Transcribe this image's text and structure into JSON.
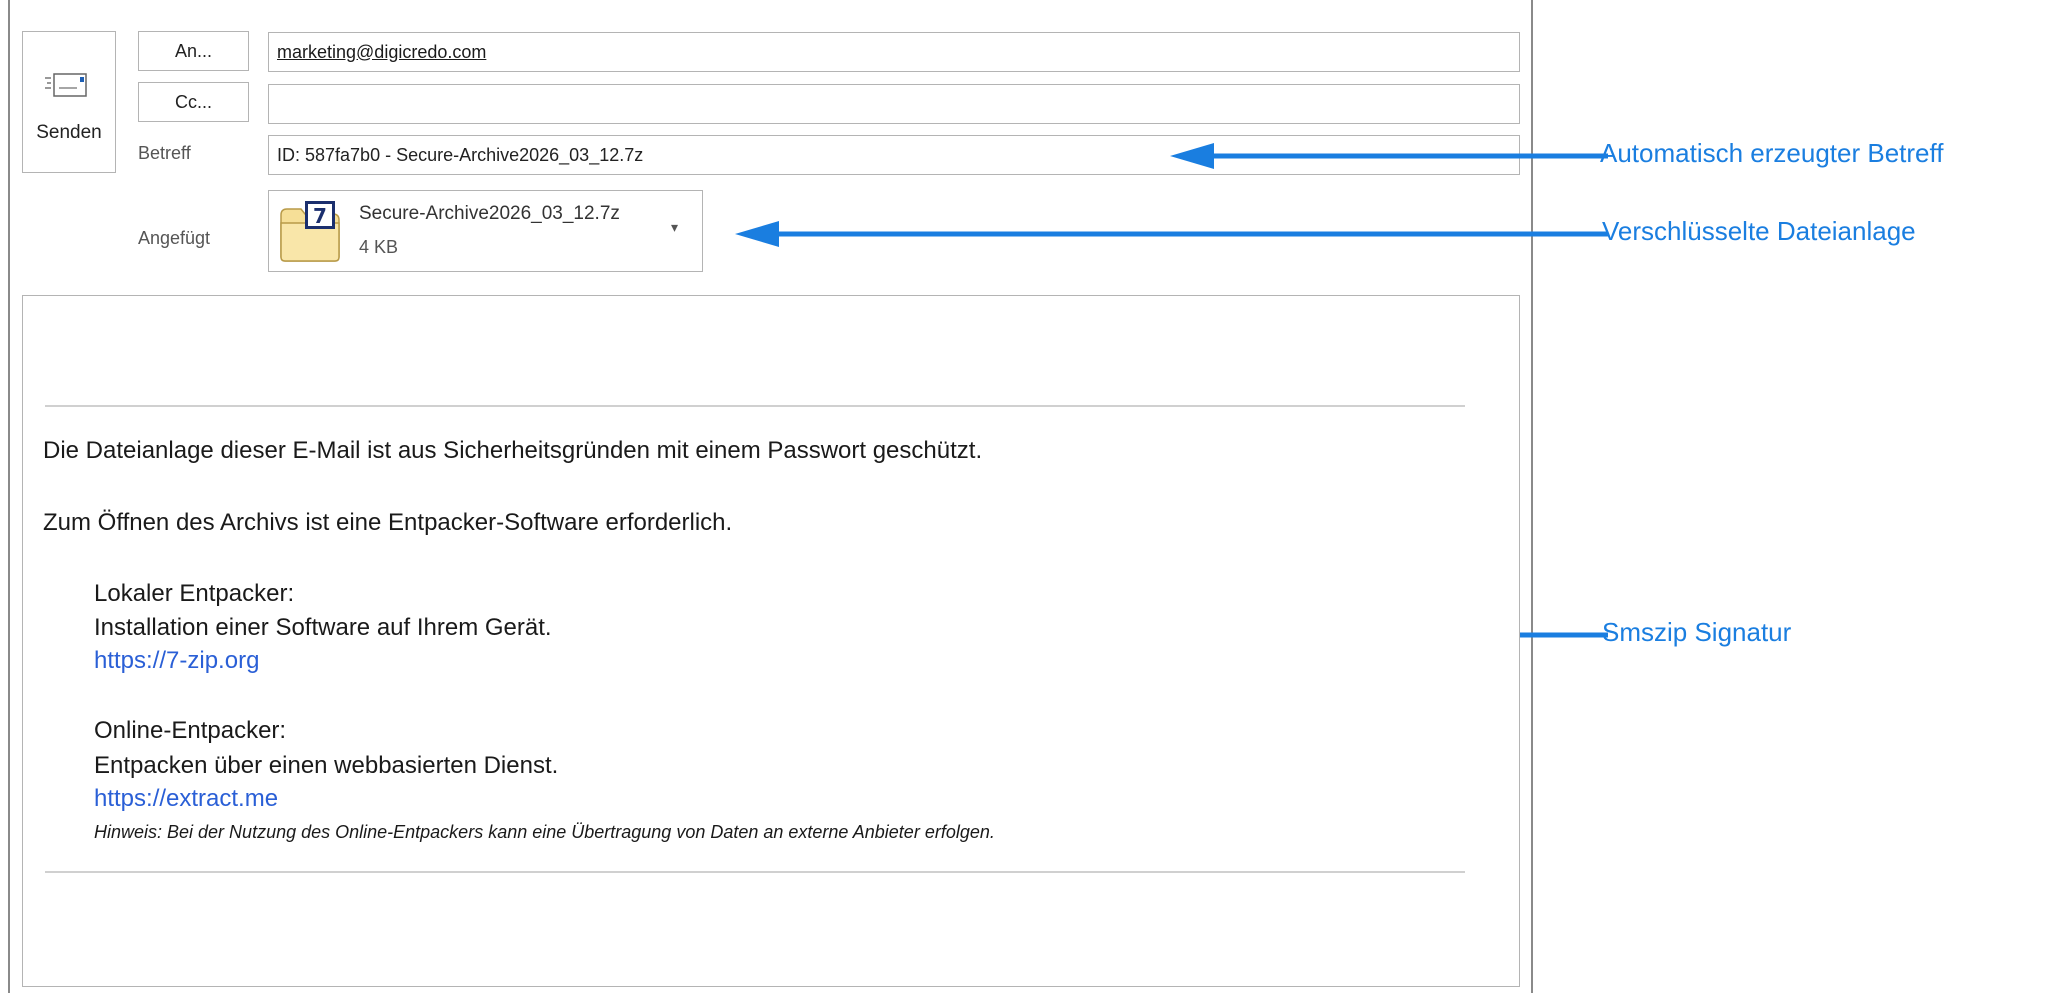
{
  "compose": {
    "send_label": "Senden",
    "to_button": "An...",
    "cc_button": "Cc...",
    "to_value": "marketing@digicredo.com",
    "cc_value": "",
    "subject_label": "Betreff",
    "subject_value": "ID: 587fa7b0 - Secure-Archive2026_03_12.7z",
    "attached_label": "Angefügt"
  },
  "attachment": {
    "name": "Secure-Archive2026_03_12.7z",
    "size": "4 KB",
    "icon_letter": "7"
  },
  "annotations": {
    "subject": "Automatisch erzeugter Betreff",
    "attachment": "Verschlüsselte Dateianlage",
    "signature": "Smszip Signatur"
  },
  "body": {
    "line1": "Die Dateianlage dieser E-Mail ist aus Sicherheitsgründen mit einem Passwort geschützt.",
    "line2": "Zum Öffnen des Archivs ist eine Entpacker-Software erforderlich.",
    "local_title": "Lokaler Entpacker:",
    "local_desc": "Installation einer Software auf Ihrem Gerät.",
    "local_link": "https://7-zip.org",
    "online_title": "Online-Entpacker:",
    "online_desc": "Entpacken über einen webbasierten Dienst.",
    "online_link": "https://extract.me",
    "note": "Hinweis: Bei der Nutzung des Online-Entpackers kann eine Übertragung von Daten an externe Anbieter erfolgen."
  },
  "colors": {
    "annotation_blue": "#1a7ee0",
    "link_blue": "#2a5fd6",
    "border_gray": "#b4b4b4"
  },
  "icons": [
    "send-icon",
    "archive-7z-icon",
    "chevron-down-icon",
    "arrow-left-icon"
  ]
}
